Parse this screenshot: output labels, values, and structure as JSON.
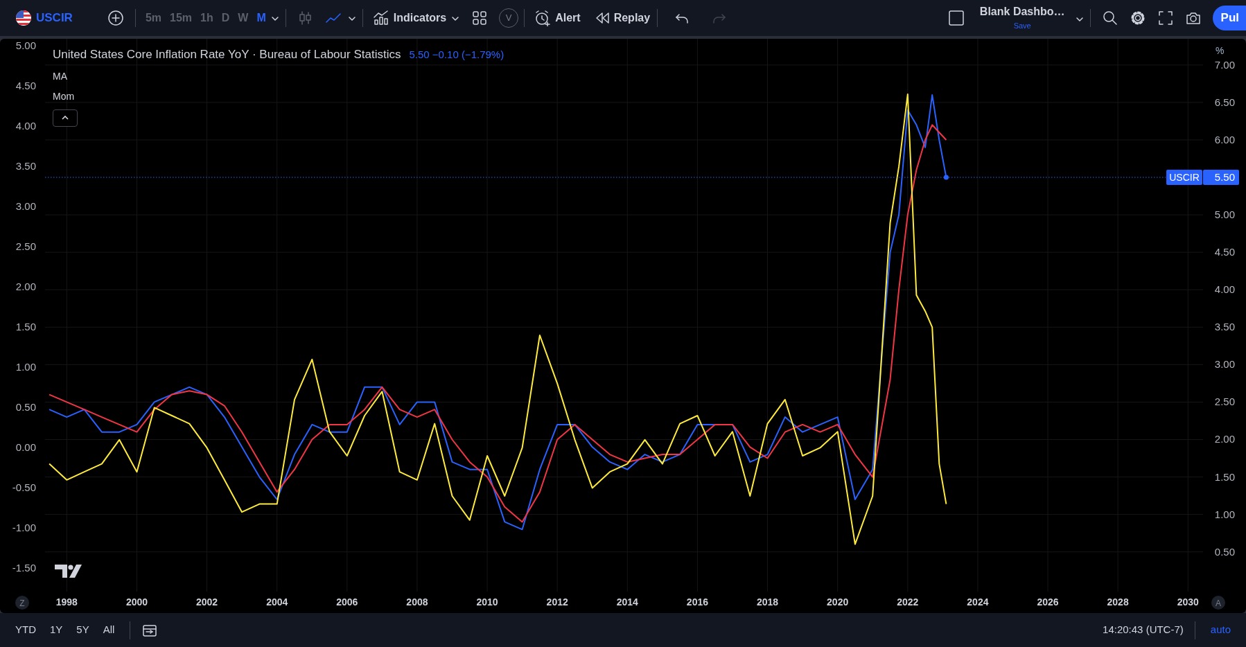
{
  "toolbar": {
    "symbol": "USCIR",
    "intervals": [
      {
        "label": "5m",
        "selected": false
      },
      {
        "label": "15m",
        "selected": false
      },
      {
        "label": "1h",
        "selected": false
      },
      {
        "label": "D",
        "selected": false
      },
      {
        "label": "W",
        "selected": false
      },
      {
        "label": "M",
        "selected": true
      }
    ],
    "chart_styles": [
      {
        "kind": "candles",
        "selected": false
      },
      {
        "kind": "line",
        "selected": true
      }
    ],
    "indicators_label": "Indicators",
    "templates_badge": "V",
    "alert_label": "Alert",
    "replay_label": "Replay",
    "history": [
      {
        "kind": "undo",
        "disabled": false
      },
      {
        "kind": "redo",
        "disabled": true
      }
    ],
    "layout": {
      "name": "Blank Dashbo…",
      "status": "Save"
    },
    "publish_label": "Pul"
  },
  "chart": {
    "legend": {
      "title": "United States Core Inflation Rate YoY · Bureau of Labour Statistics",
      "values": "5.50 −0.10 (−1.79%)"
    },
    "price_label": {
      "value": "5.50"
    },
    "scale_badges": [
      "Z",
      "A"
    ],
    "chart_data": {
      "type": "line",
      "x": [
        1997.5,
        1998,
        1998.5,
        1999,
        1999.5,
        2000,
        2000.5,
        2001,
        2001.5,
        2002,
        2002.5,
        2003,
        2003.5,
        2004,
        2004.5,
        2005,
        2005.5,
        2006,
        2006.5,
        2007,
        2007.5,
        2008,
        2008.5,
        2009,
        2009.5,
        2010,
        2010.5,
        2011,
        2011.5,
        2012,
        2012.5,
        2013,
        2013.5,
        2014,
        2014.5,
        2015,
        2015.5,
        2016,
        2016.5,
        2017,
        2017.5,
        2018,
        2018.5,
        2019,
        2019.5,
        2020,
        2020.5,
        2021,
        2021.5,
        2021.75,
        2022,
        2022.25,
        2022.5,
        2022.7,
        2022.9,
        2023.1
      ],
      "series": [
        {
          "name": "USCIR",
          "color": "#2962ff",
          "axis": "y2",
          "values": [
            2.4,
            2.3,
            2.4,
            2.1,
            2.1,
            2.2,
            2.5,
            2.6,
            2.7,
            2.6,
            2.3,
            1.9,
            1.5,
            1.2,
            1.8,
            2.2,
            2.1,
            2.1,
            2.7,
            2.7,
            2.2,
            2.5,
            2.5,
            1.7,
            1.6,
            1.6,
            0.9,
            0.8,
            1.6,
            2.2,
            2.2,
            1.9,
            1.7,
            1.6,
            1.8,
            1.7,
            1.8,
            2.2,
            2.2,
            2.2,
            1.7,
            1.8,
            2.3,
            2.1,
            2.2,
            2.3,
            1.2,
            1.6,
            4.5,
            5.0,
            6.4,
            6.2,
            5.9,
            6.6,
            6.0,
            5.5
          ]
        },
        {
          "name": "MA",
          "color": "#f23645",
          "axis": "y2",
          "values": [
            2.6,
            2.5,
            2.4,
            2.3,
            2.2,
            2.1,
            2.4,
            2.6,
            2.65,
            2.6,
            2.45,
            2.1,
            1.7,
            1.3,
            1.6,
            2.0,
            2.2,
            2.2,
            2.4,
            2.7,
            2.4,
            2.3,
            2.4,
            2.0,
            1.7,
            1.5,
            1.1,
            0.9,
            1.3,
            2.0,
            2.2,
            2.0,
            1.8,
            1.7,
            1.75,
            1.8,
            1.8,
            2.0,
            2.2,
            2.2,
            1.9,
            1.75,
            2.1,
            2.2,
            2.1,
            2.2,
            1.8,
            1.5,
            2.8,
            4.0,
            5.0,
            5.6,
            6.0,
            6.2,
            6.1,
            6.0
          ]
        },
        {
          "name": "Mom",
          "color": "#ffeb3b",
          "axis": "y",
          "values": [
            -0.2,
            -0.4,
            -0.3,
            -0.2,
            0.1,
            -0.3,
            0.5,
            0.4,
            0.3,
            0.0,
            -0.4,
            -0.8,
            -0.7,
            -0.7,
            0.6,
            1.1,
            0.2,
            -0.1,
            0.4,
            0.7,
            -0.3,
            -0.4,
            0.3,
            -0.6,
            -0.9,
            -0.1,
            -0.6,
            0.0,
            1.4,
            0.8,
            0.1,
            -0.5,
            -0.3,
            -0.2,
            0.1,
            -0.2,
            0.3,
            0.4,
            -0.1,
            0.2,
            -0.6,
            0.3,
            0.6,
            -0.1,
            0.0,
            0.2,
            -1.2,
            -0.6,
            2.8,
            3.5,
            4.4,
            1.9,
            1.7,
            1.5,
            -0.2,
            -0.7
          ]
        }
      ],
      "grid": true,
      "ref_lines": [
        {
          "value": 5.5,
          "axis": "y2",
          "color": "#2962ff"
        }
      ],
      "xlim": [
        1997.38,
        2030.43
      ],
      "xticks": [
        1998,
        2000,
        2002,
        2004,
        2006,
        2008,
        2010,
        2012,
        2014,
        2016,
        2018,
        2020,
        2022,
        2024,
        2026,
        2028,
        2030
      ],
      "ylim": [
        -1.79,
        5.09
      ],
      "yticks": [
        {
          "value": 5,
          "label": "5.00"
        },
        {
          "value": 4.5,
          "label": "4.50"
        },
        {
          "value": 4,
          "label": "4.00"
        },
        {
          "value": 3.5,
          "label": "3.50"
        },
        {
          "value": 3,
          "label": "3.00"
        },
        {
          "value": 2.5,
          "label": "2.50"
        },
        {
          "value": 2,
          "label": "2.00"
        },
        {
          "value": 1.5,
          "label": "1.50"
        },
        {
          "value": 1,
          "label": "1.00"
        },
        {
          "value": 0.5,
          "label": "0.50"
        },
        {
          "value": 0,
          "label": "0.00"
        },
        {
          "value": -0.5,
          "label": "-0.50"
        },
        {
          "value": -1,
          "label": "-1.00"
        },
        {
          "value": -1.5,
          "label": "-1.50"
        }
      ],
      "y2label": "%",
      "y2lim": [
        -0.03,
        7.35
      ],
      "y2ticks": [
        {
          "value": 7,
          "label": "7.00"
        },
        {
          "value": 6.5,
          "label": "6.50"
        },
        {
          "value": 6,
          "label": "6.00"
        },
        {
          "value": 5,
          "label": "5.00"
        },
        {
          "value": 4.5,
          "label": "4.50"
        },
        {
          "value": 4,
          "label": "4.00"
        },
        {
          "value": 3.5,
          "label": "3.50"
        },
        {
          "value": 3,
          "label": "3.00"
        },
        {
          "value": 2.5,
          "label": "2.50"
        },
        {
          "value": 2,
          "label": "2.00"
        },
        {
          "value": 1.5,
          "label": "1.50"
        },
        {
          "value": 1,
          "label": "1.00"
        },
        {
          "value": 0.5,
          "label": "0.50"
        }
      ]
    }
  },
  "bottom_bar": {
    "ranges": [
      "YTD",
      "1Y",
      "5Y",
      "All"
    ],
    "time": "14:20:43 (UTC-7)",
    "scale_mode": "auto"
  }
}
